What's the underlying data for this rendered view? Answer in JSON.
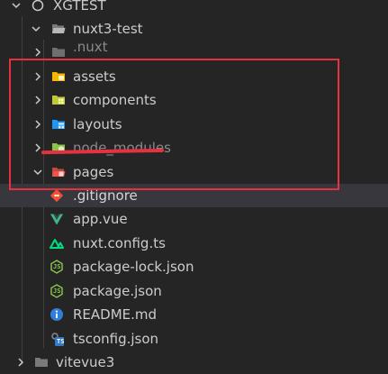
{
  "explorer": {
    "root": {
      "label": "XGTEST",
      "expanded": true
    },
    "project": {
      "label": "nuxt3-test",
      "expanded": true
    },
    "items": [
      {
        "label": ".nuxt",
        "kind": "folder",
        "expanded": false,
        "icon": "nuxt-folder-icon",
        "dimmed": true
      },
      {
        "label": "assets",
        "kind": "folder",
        "expanded": false,
        "icon": "assets-folder-icon"
      },
      {
        "label": "components",
        "kind": "folder",
        "expanded": false,
        "icon": "components-folder-icon"
      },
      {
        "label": "layouts",
        "kind": "folder",
        "expanded": false,
        "icon": "layouts-folder-icon"
      },
      {
        "label": "node_modules",
        "kind": "folder",
        "expanded": false,
        "icon": "node-modules-folder-icon",
        "struck_through": true
      },
      {
        "label": "pages",
        "kind": "folder",
        "expanded": true,
        "icon": "pages-folder-icon"
      },
      {
        "label": ".gitignore",
        "kind": "file",
        "icon": "git-icon",
        "selected": true
      },
      {
        "label": "app.vue",
        "kind": "file",
        "icon": "vue-icon"
      },
      {
        "label": "nuxt.config.ts",
        "kind": "file",
        "icon": "nuxt-icon"
      },
      {
        "label": "package-lock.json",
        "kind": "file",
        "icon": "nodejs-icon"
      },
      {
        "label": "package.json",
        "kind": "file",
        "icon": "nodejs-icon"
      },
      {
        "label": "README.md",
        "kind": "file",
        "icon": "info-icon"
      },
      {
        "label": "tsconfig.json",
        "kind": "file",
        "icon": "typescript-config-icon"
      }
    ],
    "sibling": {
      "label": "vitevue3",
      "expanded": false
    }
  },
  "annotation": {
    "highlight_color": "#e5323f"
  },
  "colors": {
    "background": "#252526",
    "selection": "#37373d",
    "text": "#cccccc",
    "vue_green": "#41b883",
    "nuxt_green": "#00dc82",
    "node_green": "#8cc84b",
    "info_blue": "#2f7ed8",
    "ts_blue": "#3178c6",
    "git_orange": "#f05033"
  }
}
